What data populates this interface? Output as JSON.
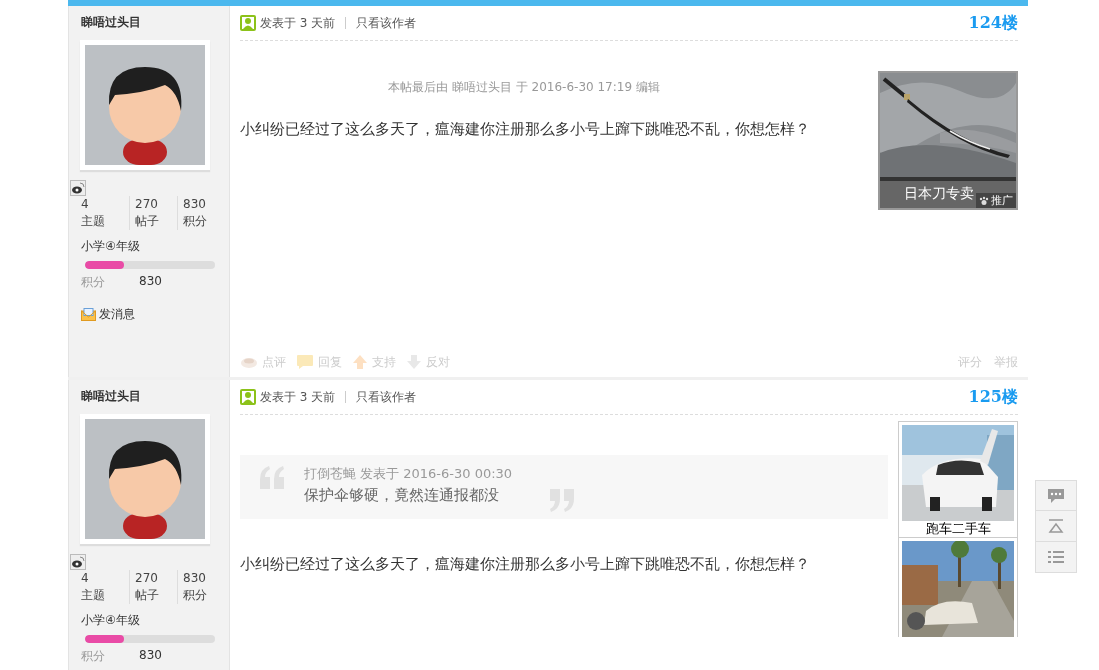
{
  "posts": [
    {
      "author": {
        "name": "睇唔过头目",
        "stats": [
          {
            "value": "4",
            "label": "主题"
          },
          {
            "value": "270",
            "label": "帖子"
          },
          {
            "value": "830",
            "label": "积分"
          }
        ],
        "rank": "小学④年级",
        "level": 0.3,
        "credits_label": "积分",
        "credits_value": "830",
        "message": "发消息"
      },
      "posted": "发表于 3 天前",
      "author_only": "只看该作者",
      "floor": "124楼",
      "edit_note": "本帖最后由 睇唔过头目 于 2016-6-30 17:19 编辑",
      "body": "小纠纷已经过了这么多天了，瘟海建你注册那么多小号上蹿下跳唯恐不乱，你想怎样？",
      "ads": [
        {
          "kind": "sword",
          "label": "日本刀专卖",
          "tag": "推广"
        }
      ],
      "actions": [
        {
          "kind": "comment",
          "label": "点评"
        },
        {
          "kind": "reply",
          "label": "回复"
        },
        {
          "kind": "up",
          "label": "支持"
        },
        {
          "kind": "down",
          "label": "反对"
        }
      ],
      "manage": [
        "评分",
        "举报"
      ]
    },
    {
      "author": {
        "name": "睇唔过头目",
        "stats": [
          {
            "value": "4",
            "label": "主题"
          },
          {
            "value": "270",
            "label": "帖子"
          },
          {
            "value": "830",
            "label": "积分"
          }
        ],
        "rank": "小学④年级",
        "level": 0.3,
        "credits_label": "积分",
        "credits_value": "830"
      },
      "posted": "发表于 3 天前",
      "author_only": "只看该作者",
      "floor": "125楼",
      "quote": {
        "author_line": "打倒苍蝇 发表于 2016-6-30 00:30",
        "text": "保护伞够硬，竟然连通报都没"
      },
      "body": "小纠纷已经过了这么多天了，瘟海建你注册那么多小号上蹿下跳唯恐不乱，你想怎样？",
      "ads": [
        {
          "kind": "car",
          "label": "跑车二手车"
        },
        {
          "kind": "street"
        }
      ]
    }
  ],
  "side_tools": [
    {
      "kind": "comment"
    },
    {
      "kind": "top"
    },
    {
      "kind": "list"
    }
  ]
}
